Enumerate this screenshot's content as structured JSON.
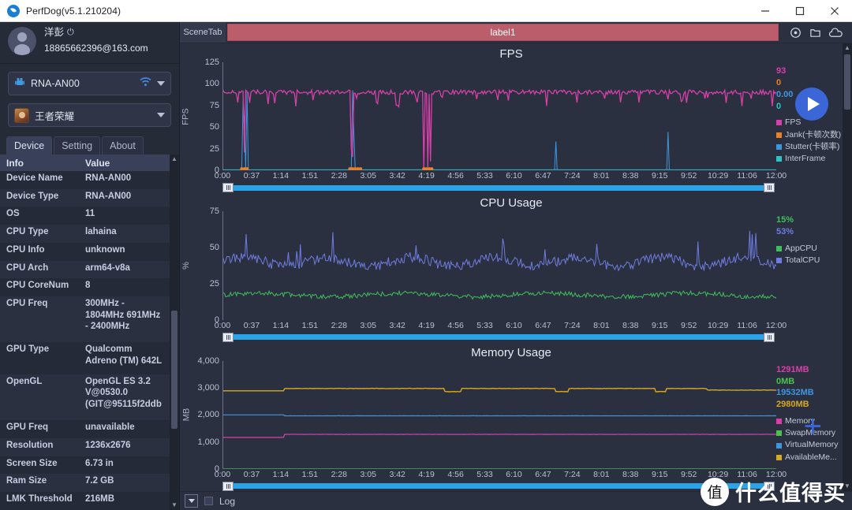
{
  "window": {
    "title": "PerfDog(v5.1.210204)",
    "logo_icon": "perfdog-logo-icon",
    "minimize_label": "–",
    "maximize_label": "□",
    "close_label": "×"
  },
  "sidebar": {
    "account": {
      "avatar_icon": "user-avatar-icon",
      "name": "洋彭",
      "power_icon": "power-icon",
      "email": "18865662396@163.com"
    },
    "device_combo": {
      "icon": "android-icon",
      "value": "RNA-AN00",
      "wifi_icon": "wifi-icon",
      "caret_icon": "chevron-down-icon"
    },
    "app_combo": {
      "icon": "game-app-icon",
      "value": "王者荣耀",
      "caret_icon": "chevron-down-icon"
    },
    "tabs": [
      {
        "label": "Device",
        "active": true
      },
      {
        "label": "Setting",
        "active": false
      },
      {
        "label": "About",
        "active": false
      }
    ],
    "table": {
      "headers": [
        "Info",
        "Value"
      ],
      "rows": [
        [
          "Device Name",
          "RNA-AN00"
        ],
        [
          "Device Type",
          "RNA-AN00"
        ],
        [
          "OS",
          "11"
        ],
        [
          "CPU Type",
          "lahaina"
        ],
        [
          "CPU Info",
          "unknown"
        ],
        [
          "CPU Arch",
          "arm64-v8a"
        ],
        [
          "CPU CoreNum",
          "8"
        ],
        [
          "CPU Freq",
          "300MHz - 1804MHz 691MHz - 2400MHz"
        ],
        [
          "GPU Type",
          "Qualcomm Adreno (TM) 642L"
        ],
        [
          "OpenGL",
          "OpenGL ES 3.2 V@0530.0 (GIT@95115f2ddb"
        ],
        [
          "GPU Freq",
          "unavailable"
        ],
        [
          "Resolution",
          "1236x2676"
        ],
        [
          "Screen Size",
          "6.73 in"
        ],
        [
          "Ram Size",
          "7.2 GB"
        ],
        [
          "LMK Threshold",
          "216MB"
        ]
      ]
    }
  },
  "scenebar": {
    "tab_label": "SceneTab",
    "label_text": "label1",
    "label_color": "#bb5d6b",
    "icons": [
      "location-pin-icon",
      "folder-icon",
      "cloud-icon"
    ]
  },
  "controls": {
    "play_icon": "play-button-icon",
    "add_icon": "add-plus-icon",
    "status_dropdown_icon": "chevron-down-icon",
    "log_label": "Log"
  },
  "watermark": {
    "logo_char": "值",
    "text": "什么值得买"
  },
  "chart_data": [
    {
      "type": "line",
      "title": "FPS",
      "ylabel": "FPS",
      "xlabel": "",
      "ylim": [
        0,
        125
      ],
      "yticks": [
        0,
        25,
        50,
        75,
        100,
        125
      ],
      "xticks": [
        "0:00",
        "0:37",
        "1:14",
        "1:51",
        "2:28",
        "3:05",
        "3:42",
        "4:19",
        "4:56",
        "5:33",
        "6:10",
        "6:47",
        "7:24",
        "8:01",
        "8:38",
        "9:15",
        "9:52",
        "10:29",
        "11:06",
        "12:00"
      ],
      "grid": false,
      "legend_position": "right",
      "readouts": [
        {
          "value": "93",
          "color": "#d83fa8"
        },
        {
          "value": "0",
          "color": "#e8812a"
        },
        {
          "value": "0.00",
          "color": "#3f96e0"
        },
        {
          "value": "0",
          "color": "#2fc4c4"
        }
      ],
      "series": [
        {
          "name": "FPS",
          "color": "#d83fa8",
          "baseline": 90
        },
        {
          "name": "Jank(卡顿次数)",
          "color": "#e8812a",
          "baseline": 0
        },
        {
          "name": "Stutter(卡顿率)",
          "color": "#3f96e0",
          "baseline": 0
        },
        {
          "name": "InterFrame",
          "color": "#2fc4c4",
          "baseline": 0
        }
      ]
    },
    {
      "type": "line",
      "title": "CPU Usage",
      "ylabel": "%",
      "xlabel": "",
      "ylim": [
        0,
        75
      ],
      "yticks": [
        0,
        25,
        50,
        75
      ],
      "xticks": [
        "0:00",
        "0:37",
        "1:14",
        "1:51",
        "2:28",
        "3:05",
        "3:42",
        "4:19",
        "4:56",
        "5:33",
        "6:10",
        "6:47",
        "7:24",
        "8:01",
        "8:38",
        "9:15",
        "9:52",
        "10:29",
        "11:06",
        "12:00"
      ],
      "grid": false,
      "legend_position": "right",
      "readouts": [
        {
          "value": "15%",
          "color": "#3fbf5a"
        },
        {
          "value": "53%",
          "color": "#6f7ce0"
        }
      ],
      "series": [
        {
          "name": "AppCPU",
          "color": "#3fbf5a",
          "baseline": 17
        },
        {
          "name": "TotalCPU",
          "color": "#6f7ce0",
          "baseline": 40
        }
      ]
    },
    {
      "type": "line",
      "title": "Memory Usage",
      "ylabel": "MB",
      "xlabel": "",
      "ylim": [
        0,
        4000
      ],
      "yticks": [
        0,
        1000,
        2000,
        3000,
        4000
      ],
      "xticks": [
        "0:00",
        "0:37",
        "1:14",
        "1:51",
        "2:28",
        "3:05",
        "3:42",
        "4:19",
        "4:56",
        "5:33",
        "6:10",
        "6:47",
        "7:24",
        "8:01",
        "8:38",
        "9:15",
        "9:52",
        "10:29",
        "11:06",
        "12:00"
      ],
      "grid": false,
      "legend_position": "right",
      "readouts": [
        {
          "value": "1291MB",
          "color": "#d83fa8"
        },
        {
          "value": "0MB",
          "color": "#4cc24c"
        },
        {
          "value": "19532MB",
          "color": "#3f96e0"
        },
        {
          "value": "2980MB",
          "color": "#d8a81e"
        }
      ],
      "series": [
        {
          "name": "Memory",
          "color": "#d83fa8",
          "baseline": 1291
        },
        {
          "name": "SwapMemory",
          "color": "#4cc24c",
          "baseline": 0
        },
        {
          "name": "VirtualMemory",
          "color": "#3f96e0",
          "baseline": 1980
        },
        {
          "name": "AvailableMe...",
          "color": "#d8a81e",
          "baseline": 2980
        }
      ]
    }
  ]
}
